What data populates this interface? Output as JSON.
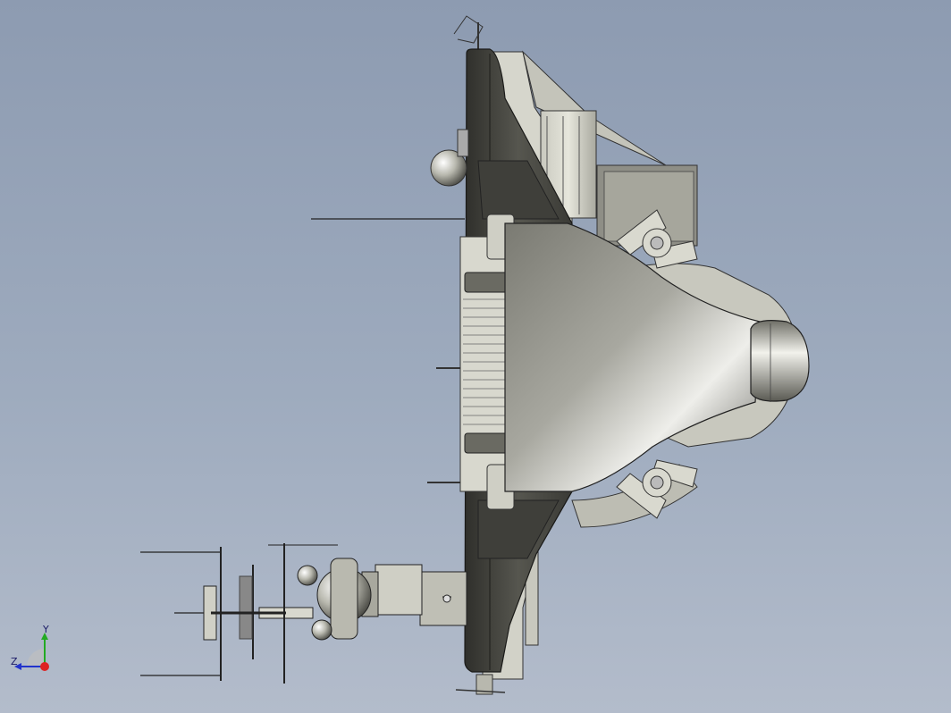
{
  "viewport": {
    "background_top": "#8d9bb1",
    "background_bottom": "#b3bccb",
    "model": "cad-assembly-side-view"
  },
  "triad": {
    "y_label": "Y",
    "z_label": "Z",
    "y_color": "#22aa22",
    "z_color": "#2233cc",
    "x_color": "#dd2222"
  }
}
